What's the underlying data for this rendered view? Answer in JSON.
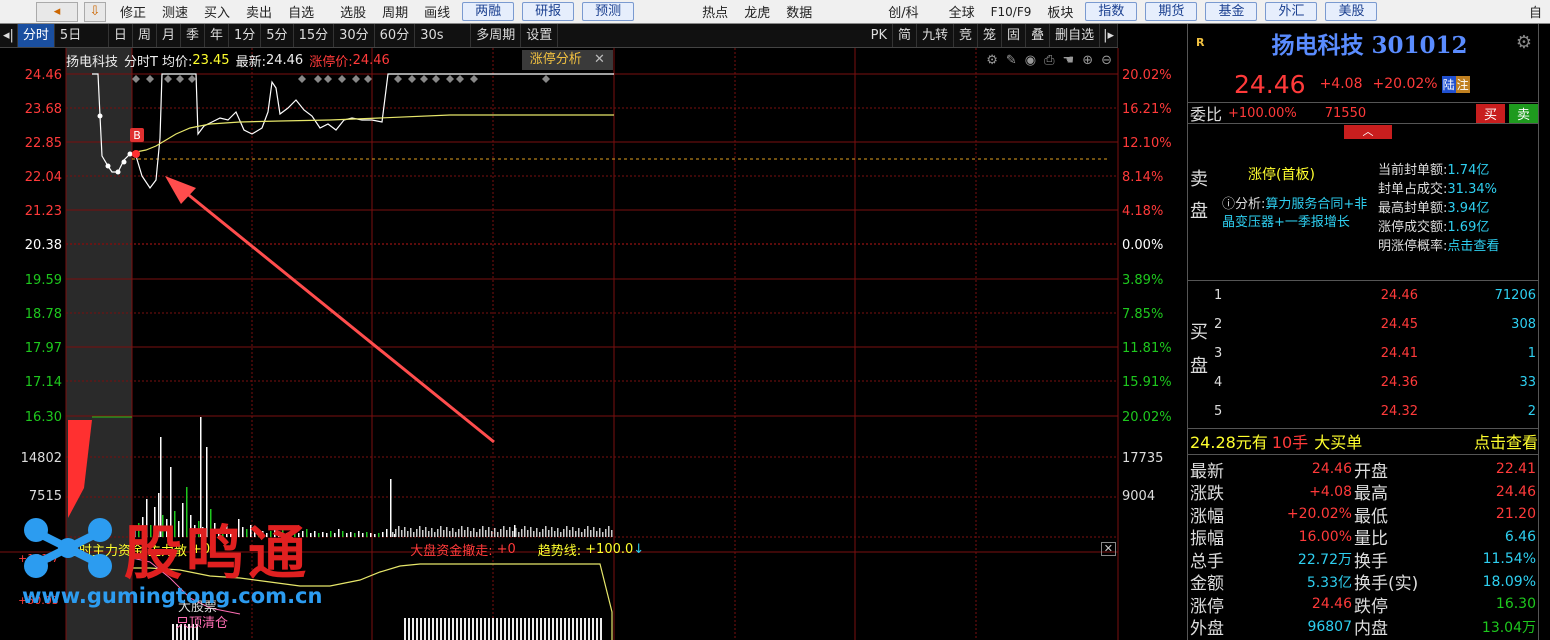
{
  "topbar": {
    "menu": [
      "修正",
      "测速",
      "买入",
      "卖出",
      "自选",
      "选股",
      "周期",
      "画线"
    ],
    "pills": [
      "两融",
      "研报",
      "预测"
    ],
    "mid_menu": [
      "热点",
      "龙虎",
      "数据"
    ],
    "right_menu": [
      "创/科",
      "全球",
      "F10/F9",
      "板块"
    ],
    "right_pills": [
      "指数",
      "期货",
      "基金",
      "外汇",
      "美股"
    ],
    "far_right": "自"
  },
  "toolbar": {
    "items": [
      "分时",
      "5日",
      "日",
      "周",
      "月",
      "季",
      "年",
      "1分",
      "5分",
      "15分",
      "30分",
      "60分",
      "30s",
      "多周期",
      "设置"
    ],
    "right_items": [
      "PK",
      "简",
      "九转",
      "竞",
      "笼",
      "固",
      "叠",
      "删自选"
    ]
  },
  "infobar": {
    "name": "扬电科技",
    "mode": "分时T",
    "avg_label": "均价:",
    "avg": "23.45",
    "last_label": "最新:",
    "last": "24.46",
    "limit_label": "涨停价:",
    "limit": "24.46",
    "tab": "涨停分析"
  },
  "axis": {
    "left_prices": [
      "24.46",
      "23.68",
      "22.85",
      "22.04",
      "21.23",
      "20.38",
      "19.59",
      "18.78",
      "17.97",
      "17.14",
      "16.30"
    ],
    "right_pcts": [
      "20.02%",
      "16.21%",
      "12.10%",
      "8.14%",
      "4.18%",
      "0.00%",
      "3.89%",
      "7.85%",
      "11.81%",
      "15.91%",
      "20.02%"
    ],
    "vol_left": [
      "14802",
      "7515"
    ],
    "vol_right": [
      "17735",
      "9004"
    ]
  },
  "indicator": {
    "text1": "分时主力资金",
    "text2": "主力散",
    "text3": "+0",
    "text4": "大盘资金撤走:",
    "text5": "+0",
    "text6": "趋势线:",
    "text7": "+100.0",
    "left1": "+101.7",
    "left2": "+50.03",
    "bottom": "只顶清仓",
    "bottom2": "大股票"
  },
  "marker": "B",
  "watermark": {
    "logo": "股鸣通",
    "url": "www.gumingtong.com.cn"
  },
  "panel": {
    "symbol_badge": "R",
    "title": "扬电科技 301012",
    "price": "24.46",
    "change": "+4.08",
    "pct": "+20.02%",
    "tag1": "陆",
    "tag2": "注",
    "weibi_label": "委比",
    "weibi": "+100.00%",
    "weicha": "71550",
    "buy_btn": "买",
    "sell_btn": "卖",
    "sell_side": "卖盘",
    "buy_side": "买盘",
    "limit_status": "涨停(首板)",
    "analysis_label": "分析:",
    "analysis": "算力服务合同+非晶变压器+一季报增长",
    "seal": [
      {
        "k": "当前封单额:",
        "v": "1.74亿"
      },
      {
        "k": "封单占成交:",
        "v": "31.34%"
      },
      {
        "k": "最高封单额:",
        "v": "3.94亿"
      },
      {
        "k": "涨停成交额:",
        "v": "1.69亿"
      },
      {
        "k": "明涨停概率:",
        "v": "点击查看"
      }
    ],
    "bids": [
      {
        "lvl": "1",
        "price": "24.46",
        "vol": "71206"
      },
      {
        "lvl": "2",
        "price": "24.45",
        "vol": "308"
      },
      {
        "lvl": "3",
        "price": "24.41",
        "vol": "1"
      },
      {
        "lvl": "4",
        "price": "24.36",
        "vol": "33"
      },
      {
        "lvl": "5",
        "price": "24.32",
        "vol": "2"
      }
    ],
    "big_order": {
      "price": "24.28元有",
      "hands": "10手",
      "label": "大买单",
      "link": "点击查看"
    },
    "stats": [
      {
        "k1": "最新",
        "v1": "24.46",
        "k2": "开盘",
        "v2": "22.41"
      },
      {
        "k1": "涨跌",
        "v1": "+4.08",
        "k2": "最高",
        "v2": "24.46"
      },
      {
        "k1": "涨幅",
        "v1": "+20.02%",
        "k2": "最低",
        "v2": "21.20"
      },
      {
        "k1": "振幅",
        "v1": "16.00%",
        "k2": "量比",
        "v2": "6.46"
      },
      {
        "k1": "总手",
        "v1": "22.72万",
        "k2": "换手",
        "v2": "11.54%"
      },
      {
        "k1": "金额",
        "v1": "5.33亿",
        "k2": "换手(实)",
        "v2": "18.09%"
      },
      {
        "k1": "涨停",
        "v1": "24.46",
        "k2": "跌停",
        "v2": "16.30"
      },
      {
        "k1": "外盘",
        "v1": "96807",
        "k2": "内盘",
        "v2": "13.04万"
      }
    ]
  },
  "colors": {
    "up": "#ff3a3a",
    "down": "#1ec81e",
    "price_line": "#ffffff",
    "avg_line": "#e6e66a",
    "grid": "#7a0f0f"
  }
}
